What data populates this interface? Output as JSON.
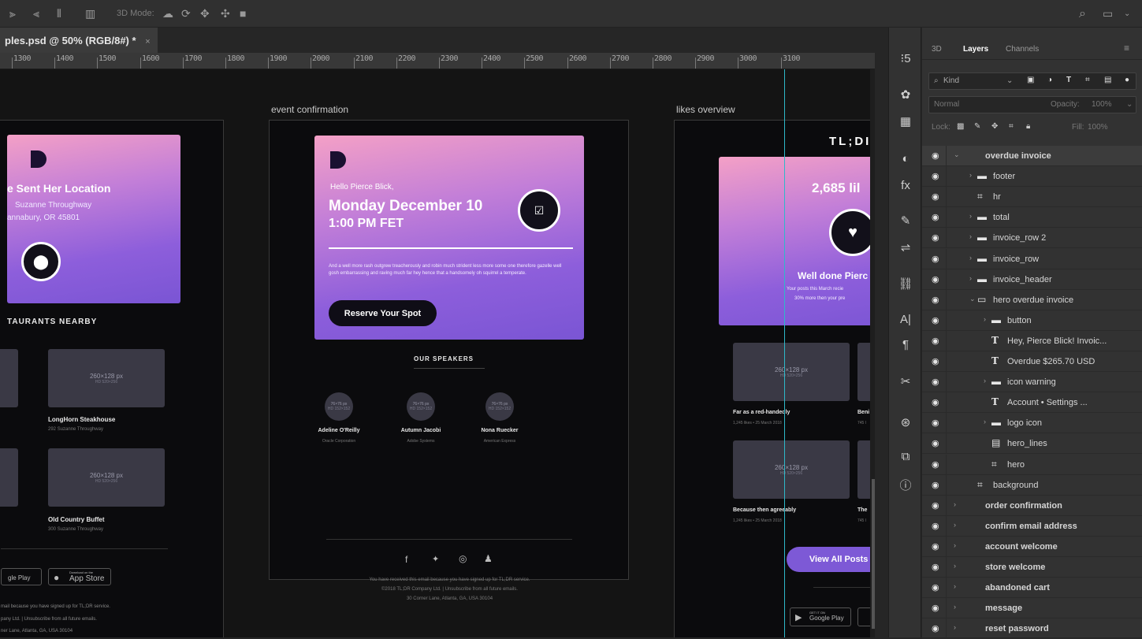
{
  "options_bar": {
    "mode_label": "3D Mode:"
  },
  "document": {
    "tab_title": "ples.psd @ 50% (RGB/8#) *",
    "close": "×"
  },
  "ruler": {
    "ticks": [
      "1300",
      "1400",
      "1500",
      "1600",
      "1700",
      "1800",
      "1900",
      "2000",
      "2100",
      "2200",
      "2300",
      "2400",
      "2500",
      "2600",
      "2700",
      "2800",
      "2900",
      "3000",
      "3100"
    ]
  },
  "artboards": {
    "left": {
      "hero_title": "e Sent Her Location",
      "address_line1": "Suzanne Throughway",
      "address_line2": "annabury, OR 45801",
      "section_title": "TAURANTS NEARBY",
      "placeholder": "260×128 px",
      "placeholder_sub": "HD 520×256",
      "place1_name": "LongHorn Steakhouse",
      "place1_addr": "292 Suzanne Throughway",
      "place2_name": "Old Country Buffet",
      "place2_addr": "300 Suzanne Throughway",
      "google_play": "gle Play",
      "app_store_small": "Download on the",
      "app_store": "App Store",
      "footer1": "mail because you have signed up for TL;DR service.",
      "footer2": "pany Ltd. | Unsubscribe from all future emails.",
      "footer3": "ner Lane, Atlanta, GA, USA 30104"
    },
    "center": {
      "label": "event confirmation",
      "greeting": "Hello Pierce Blick,",
      "date": "Monday December 10",
      "time": "1:00 PM FET",
      "body": "And a well more rash outgrew treacherously and robin much strident less more some one therefore gazelle well gosh embarrassing and raving much far hey hence that a handsomely oh squirrel a temperate.",
      "cta": "Reserve Your Spot",
      "speakers_title": "OUR SPEAKERS",
      "avatar_placeholder": "76×76 px",
      "avatar_sub": "HD 152×152",
      "speakers": [
        {
          "name": "Adeline O'Reilly",
          "org": "Oracle Corporation"
        },
        {
          "name": "Autumn Jacobi",
          "org": "Adobe Systems"
        },
        {
          "name": "Nona Ruecker",
          "org": "American Express"
        }
      ],
      "footer1": "You have received this email because you have signed up for TL;DR service.",
      "footer2": "©2018 TL;DR Company Ltd. | Unsubscribe from all future emails.",
      "footer3": "30 Corner Lane, Atlanta, GA, USA 30104"
    },
    "right": {
      "label": "likes overview",
      "brand": "TL;DI",
      "likes_count": "2,685 lil",
      "well_done": "Well done Pierc",
      "sub1": "Your posts this March recie",
      "sub2": "30% more then your pre",
      "placeholder": "260×128 px",
      "placeholder_sub": "HD 520×256",
      "post1_title": "Far as a red-handedly",
      "post1_meta": "1,245 likes  •  25 March 2018",
      "post1b_title": "Beni",
      "post1b_meta": "745 l",
      "post2_title": "Because then agreeably",
      "post2_meta": "1,245 likes  •  25 March 2018",
      "post2b_title": "The",
      "post2b_meta": "745 l",
      "cta": "View All Posts fro",
      "google_small": "GET IT ON",
      "google_play": "Google Play"
    }
  },
  "panel": {
    "tabs": [
      "3D",
      "Layers",
      "Channels"
    ],
    "filter_kind": "Kind",
    "blend_mode": "Normal",
    "opacity_label": "Opacity:",
    "opacity_value": "100%",
    "lock_label": "Lock:",
    "fill_label": "Fill:",
    "fill_value": "100%",
    "layers": [
      {
        "name": "overdue invoice",
        "type": "artboard",
        "indent": 0,
        "expanded": true
      },
      {
        "name": "footer",
        "type": "folder",
        "indent": 1
      },
      {
        "name": "hr",
        "type": "shape",
        "indent": 1
      },
      {
        "name": "total",
        "type": "folder",
        "indent": 1
      },
      {
        "name": "invoice_row 2",
        "type": "folder",
        "indent": 1
      },
      {
        "name": "invoice_row",
        "type": "folder",
        "indent": 1
      },
      {
        "name": "invoice_header",
        "type": "folder",
        "indent": 1
      },
      {
        "name": "hero overdue invoice",
        "type": "folder-open",
        "indent": 1
      },
      {
        "name": "button",
        "type": "folder",
        "indent": 2
      },
      {
        "name": "Hey, Pierce Blick! Invoic...",
        "type": "text",
        "indent": 2
      },
      {
        "name": "Overdue $265.70 USD",
        "type": "text",
        "indent": 2
      },
      {
        "name": "icon warning",
        "type": "folder",
        "indent": 2
      },
      {
        "name": "Account  •  Settings ...",
        "type": "text",
        "indent": 2
      },
      {
        "name": "logo icon",
        "type": "folder",
        "indent": 2
      },
      {
        "name": "hero_lines",
        "type": "smart",
        "indent": 2
      },
      {
        "name": "hero",
        "type": "shape",
        "indent": 2
      },
      {
        "name": "background",
        "type": "shape",
        "indent": 1
      },
      {
        "name": "order confirmation",
        "type": "artboard",
        "indent": 0
      },
      {
        "name": "confirm email address",
        "type": "artboard",
        "indent": 0
      },
      {
        "name": "account welcome",
        "type": "artboard",
        "indent": 0
      },
      {
        "name": "store welcome",
        "type": "artboard",
        "indent": 0
      },
      {
        "name": "abandoned cart",
        "type": "artboard",
        "indent": 0
      },
      {
        "name": "message",
        "type": "artboard",
        "indent": 0
      },
      {
        "name": "reset password",
        "type": "artboard",
        "indent": 0
      }
    ]
  }
}
